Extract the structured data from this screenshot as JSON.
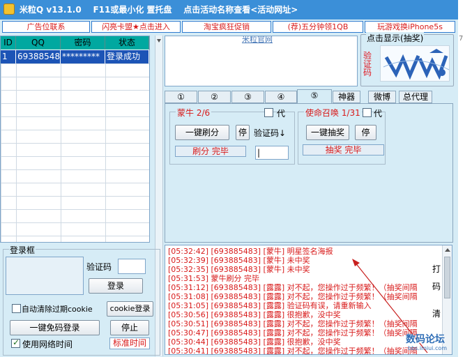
{
  "title": {
    "app": "米粒Q v13.1.0",
    "hint1": "F11或最小化 置托盘",
    "hint2": "点击活动名称查看<活动网址>"
  },
  "ad_bar": [
    "广告位联系",
    "闪亮卡盟★点击进入",
    "淘宝疯狂促销",
    "(荐)五分钟领1QB",
    "玩游戏换iPhone5s"
  ],
  "grid": {
    "headers": [
      "ID",
      "QQ",
      "密码",
      "状态"
    ],
    "rows": [
      {
        "id": "1",
        "qq": "69388548",
        "password": "*********",
        "status": "登录成功"
      }
    ]
  },
  "web": {
    "link_text": "米粒官网"
  },
  "captcha": {
    "legend": "点击显示(抽奖)",
    "vertical_label": "验证码",
    "image_text": "wvw"
  },
  "tabs": [
    "①",
    "②",
    "③",
    "④",
    "⑤",
    "神器",
    "微博",
    "总代理"
  ],
  "active_tab": 4,
  "mengniu": {
    "title": "蒙牛 2/6",
    "agent_label": "代",
    "btn_brush": "一键刷分",
    "btn_stop": "停",
    "captcha_label": "验证码↓",
    "status": "刷分 完毕",
    "captcha_value": "|"
  },
  "cod": {
    "title": "使命召唤 1/31",
    "agent_label": "代",
    "btn_draw": "一键抽奖",
    "btn_stop": "停",
    "status": "抽奖  完毕"
  },
  "login": {
    "legend": "登录框",
    "captcha_label": "验证码",
    "login_btn": "登录",
    "auto_clear_label": "自动清除过期cookie",
    "cookie_login_btn": "cookie登录",
    "one_key_btn": "一键免码登录",
    "stop_btn": "停止",
    "net_time_label": "使用网络时间",
    "std_time_btn": "标准时间"
  },
  "log": [
    "[05:32:42] [693885483] [蒙牛] 明星签名海报",
    "[05:32:39] [693885483] [蒙牛] 未中奖",
    "[05:32:35] [693885483] [蒙牛] 未中奖",
    "[05:31:53] 蒙牛刷分    完毕",
    "[05:31:12] [693885483] [露露] 对不起，您操作过于频繁！（抽奖间隔",
    "[05:31:08] [693885483] [露露] 对不起，您操作过于频繁！（抽奖间隔",
    "[05:31:05] [693885483] [露露] 验证码有误，请重新输入",
    "[05:30:56] [693885483] [露露] 很抱歉，没中奖",
    "[05:30:51] [693885483] [露露] 对不起，您操作过于频繁！（抽奖间隔",
    "[05:30:47] [693885483] [露露] 对不起，您操作过于频繁！（抽奖间隔",
    "[05:30:44] [693885483] [露露] 很抱歉，没中奖",
    "[05:30:41] [693885483] [露露] 对不起，您操作过于频繁！（抽奖间隔"
  ],
  "side_chars": [
    "打",
    "码",
    "清"
  ],
  "watermark": {
    "text": "数码论坛",
    "url": "bbs.imiui.com"
  },
  "outside_char": "7"
}
